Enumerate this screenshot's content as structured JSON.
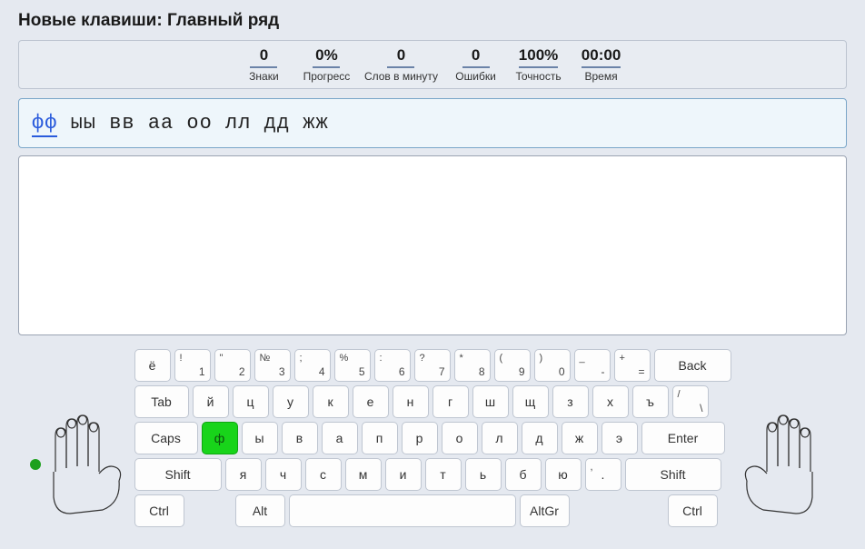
{
  "title": "Новые клавиши: Главный ряд",
  "stats": {
    "chars": {
      "value": "0",
      "label": "Знаки"
    },
    "progress": {
      "value": "0%",
      "label": "Прогресс"
    },
    "wpm": {
      "value": "0",
      "label": "Слов в минуту"
    },
    "errors": {
      "value": "0",
      "label": "Ошибки"
    },
    "accuracy": {
      "value": "100%",
      "label": "Точность"
    },
    "time": {
      "value": "00:00",
      "label": "Время"
    }
  },
  "target": {
    "current": "фф",
    "rest": " ыы вв аа оо лл дд жж"
  },
  "input": {
    "value": ""
  },
  "highlight_key": "ф",
  "keyboard": {
    "row1": [
      {
        "main": "ё"
      },
      {
        "upper": "!",
        "lower": "1"
      },
      {
        "upper": "\"",
        "lower": "2"
      },
      {
        "upper": "№",
        "lower": "3"
      },
      {
        "upper": ";",
        "lower": "4"
      },
      {
        "upper": "%",
        "lower": "5"
      },
      {
        "upper": ":",
        "lower": "6"
      },
      {
        "upper": "?",
        "lower": "7"
      },
      {
        "upper": "*",
        "lower": "8"
      },
      {
        "upper": "(",
        "lower": "9"
      },
      {
        "upper": ")",
        "lower": "0"
      },
      {
        "upper": "_",
        "lower": "-"
      },
      {
        "upper": "+",
        "lower": "="
      },
      {
        "main": "Back",
        "class": "wide-back",
        "name": "backspace-key"
      }
    ],
    "row2": [
      {
        "main": "Tab",
        "class": "wide-15",
        "name": "tab-key"
      },
      {
        "main": "й"
      },
      {
        "main": "ц"
      },
      {
        "main": "у"
      },
      {
        "main": "к"
      },
      {
        "main": "е"
      },
      {
        "main": "н"
      },
      {
        "main": "г"
      },
      {
        "main": "ш"
      },
      {
        "main": "щ"
      },
      {
        "main": "з"
      },
      {
        "main": "х"
      },
      {
        "main": "ъ"
      },
      {
        "upper": "/",
        "lower": "\\"
      }
    ],
    "row3": [
      {
        "main": "Caps",
        "class": "wide-175",
        "name": "caps-key"
      },
      {
        "main": "ф"
      },
      {
        "main": "ы"
      },
      {
        "main": "в"
      },
      {
        "main": "а"
      },
      {
        "main": "п"
      },
      {
        "main": "р"
      },
      {
        "main": "о"
      },
      {
        "main": "л"
      },
      {
        "main": "д"
      },
      {
        "main": "ж"
      },
      {
        "main": "э"
      },
      {
        "main": "Enter",
        "class": "wide-enter",
        "name": "enter-key"
      }
    ],
    "row4": [
      {
        "main": "Shift",
        "class": "wide-225",
        "name": "left-shift-key"
      },
      {
        "main": "я"
      },
      {
        "main": "ч"
      },
      {
        "main": "с"
      },
      {
        "main": "м"
      },
      {
        "main": "и"
      },
      {
        "main": "т"
      },
      {
        "main": "ь"
      },
      {
        "main": "б"
      },
      {
        "main": "ю"
      },
      {
        "upper": ",",
        "main": "."
      },
      {
        "main": "Shift",
        "class": "wide-25",
        "name": "right-shift-key"
      }
    ],
    "row5": [
      {
        "main": "Ctrl",
        "class": "wide-ctrl",
        "name": "left-ctrl-key"
      },
      {
        "spacer": "spacer"
      },
      {
        "main": "Alt",
        "class": "wide-ctrl",
        "name": "left-alt-key"
      },
      {
        "main": "",
        "class": "space",
        "name": "space-key"
      },
      {
        "main": "AltGr",
        "class": "wide-ctrl",
        "name": "altgr-key"
      },
      {
        "spacer": "spacer2"
      },
      {
        "main": "Ctrl",
        "class": "wide-ctrl",
        "name": "right-ctrl-key"
      }
    ]
  }
}
